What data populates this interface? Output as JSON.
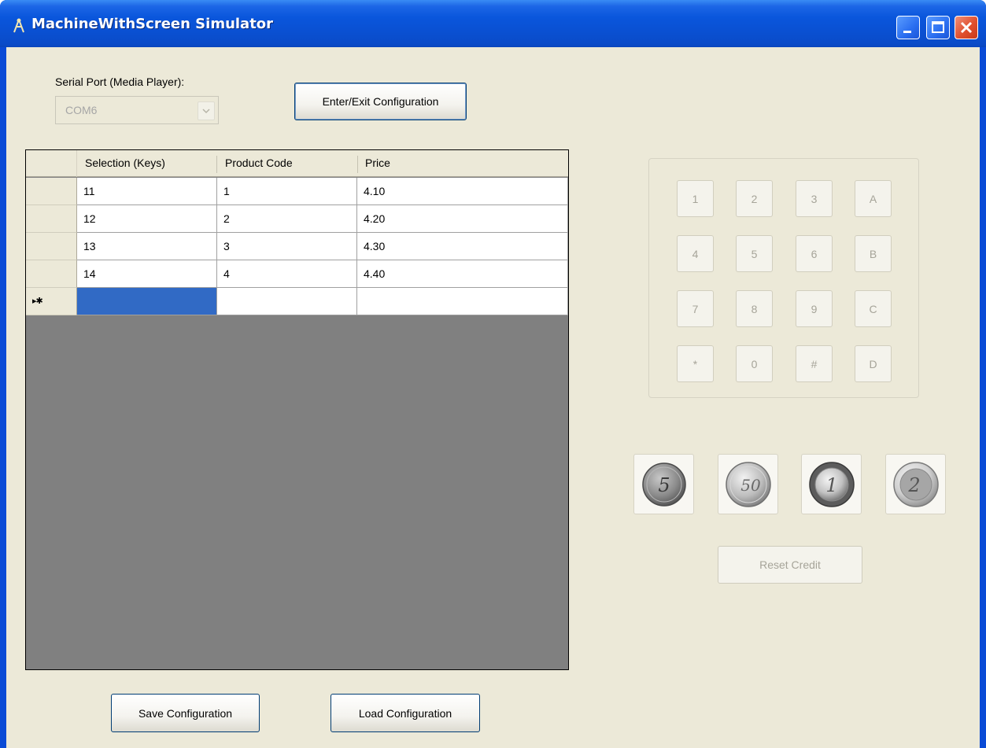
{
  "window": {
    "title": "MachineWithScreen Simulator"
  },
  "config": {
    "serial_port_label": "Serial Port (Media Player):",
    "serial_port_value": "COM6",
    "enter_exit_label": "Enter/Exit Configuration",
    "save_label": "Save Configuration",
    "load_label": "Load Configuration"
  },
  "grid": {
    "columns": [
      "Selection (Keys)",
      "Product Code",
      "Price"
    ],
    "rows": [
      [
        "11",
        "1",
        "4.10"
      ],
      [
        "12",
        "2",
        "4.20"
      ],
      [
        "13",
        "3",
        "4.30"
      ],
      [
        "14",
        "4",
        "4.40"
      ]
    ],
    "new_row_marker": "▸✱"
  },
  "keypad": {
    "keys": [
      "1",
      "2",
      "3",
      "A",
      "4",
      "5",
      "6",
      "B",
      "7",
      "8",
      "9",
      "C",
      "*",
      "0",
      "#",
      "D"
    ]
  },
  "coins": [
    {
      "name": "5-cent-coin-icon",
      "label": "5"
    },
    {
      "name": "50-cent-coin-icon",
      "label": "50"
    },
    {
      "name": "1-euro-coin-icon",
      "label": "1"
    },
    {
      "name": "2-euro-coin-icon",
      "label": "2"
    }
  ],
  "reset_credit_label": "Reset Credit",
  "colors": {
    "title_bar": "#0a56dc",
    "client_bg": "#ece9d8",
    "selection": "#316ac5"
  }
}
